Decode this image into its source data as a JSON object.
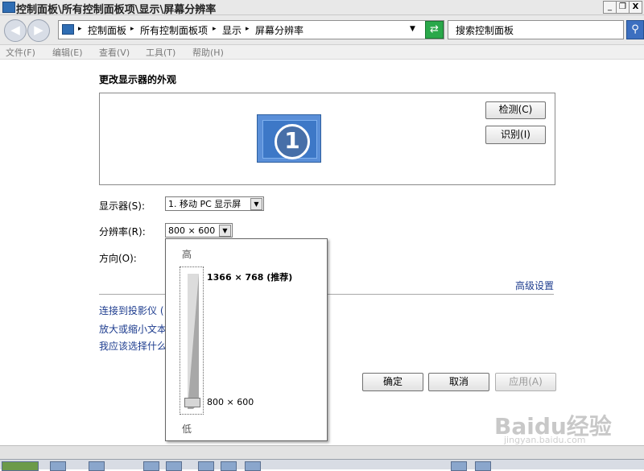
{
  "window": {
    "title": "控制面板\\所有控制面板项\\显示\\屏幕分辨率",
    "minimize": "_",
    "restore": "❐",
    "close": "X"
  },
  "nav": {
    "back": "◀",
    "forward": "▶",
    "breadcrumbs": [
      "控制面板",
      "所有控制面板项",
      "显示",
      "屏幕分辨率"
    ],
    "search_placeholder": "搜索控制面板"
  },
  "menu": {
    "items": [
      "文件(F)",
      "编辑(E)",
      "查看(V)",
      "工具(T)",
      "帮助(H)"
    ]
  },
  "main": {
    "heading": "更改显示器的外观",
    "monitor_number": "1",
    "detect_button": "检测(C)",
    "identify_button": "识别(I)",
    "display_label": "显示器(S):",
    "display_value": "1. 移动 PC 显示屏",
    "resolution_label": "分辨率(R):",
    "resolution_value": "800 × 600",
    "orientation_label": "方向(O):",
    "advanced_link": "高级设置",
    "links": [
      "连接到投影仪 (",
      "放大或缩小文本",
      "我应该选择什么"
    ],
    "ok_button": "确定",
    "cancel_button": "取消",
    "apply_button": "应用(A)"
  },
  "resolution_dropdown": {
    "high_label": "高",
    "low_label": "低",
    "max_resolution": "1366 × 768 (推荐)",
    "current_resolution": "800 × 600",
    "slider_position": 0.0
  },
  "watermark": {
    "brand": "Baidu经验",
    "url": "jingyan.baidu.com"
  }
}
